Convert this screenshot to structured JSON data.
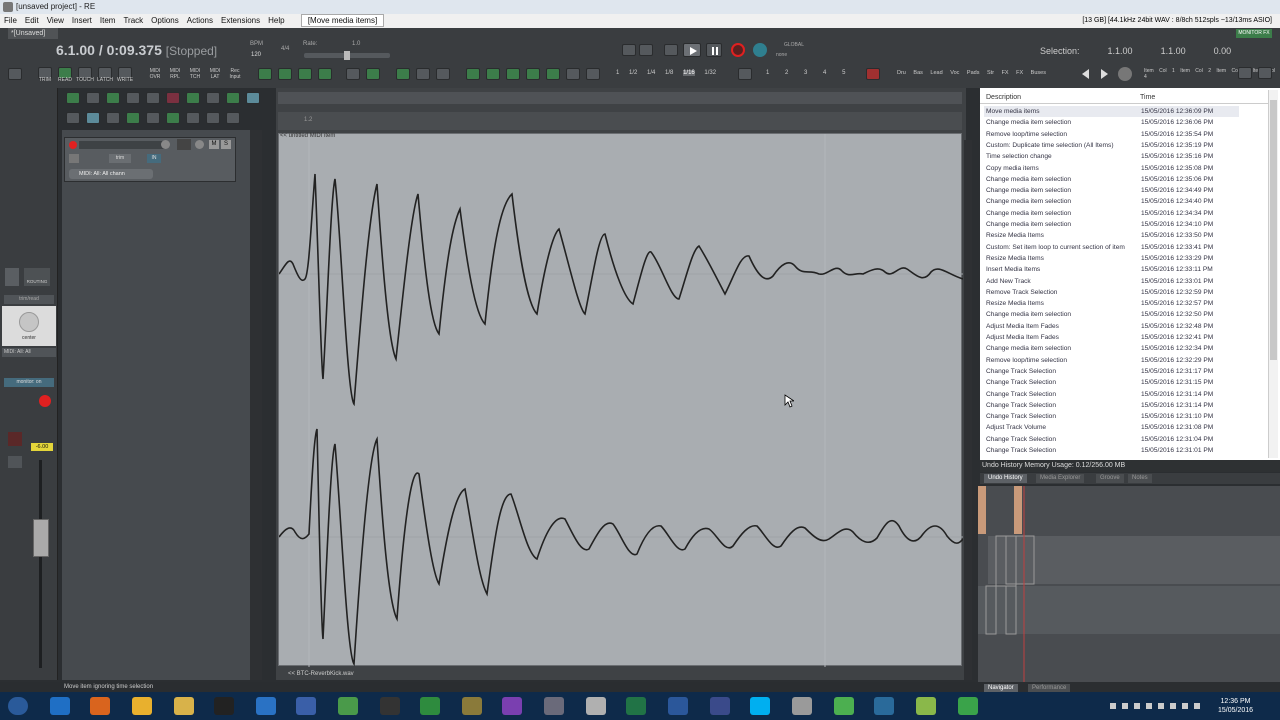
{
  "window": {
    "title": "[unsaved project] - RE",
    "project_tab": "*[Unsaved]"
  },
  "menu": {
    "items": [
      "File",
      "Edit",
      "View",
      "Insert",
      "Item",
      "Track",
      "Options",
      "Actions",
      "Extensions",
      "Help"
    ],
    "last_action": "[Move media items]",
    "audio_status": "[13 GB] [44.1kHz 24bit WAV : 8/8ch 512spls ~13/13ms ASIO]"
  },
  "transport": {
    "position": "6.1.00 / 0:09.375",
    "state": "[Stopped]",
    "bpm_label": "BPM",
    "bpm": "120",
    "timesig": "4/4",
    "rate_label": "Rate:",
    "rate": "1.0",
    "global_label": "GLOBAL",
    "global_sub": "none",
    "monitor_fx": "MONITOR FX"
  },
  "selection": {
    "label": "Selection:",
    "start": "1.1.00",
    "end": "1.1.00",
    "length": "0.00"
  },
  "toolbar_labels": [
    "TRIM",
    "READ",
    "TOUCH",
    "LATCH",
    "WRITE"
  ],
  "midi_labels": [
    "MIDI OVR",
    "MIDI RPL",
    "MIDI TCH",
    "MIDI LAT",
    "Rec Input"
  ],
  "grid_labels": [
    "1",
    "1/2",
    "1/4",
    "1/8",
    "1/16",
    "1/32"
  ],
  "num_labels": [
    "1",
    "2",
    "3",
    "4",
    "5"
  ],
  "cat_labels": [
    "Dru",
    "Bas",
    "Lead",
    "Voc",
    "Pads",
    "Str",
    "FX",
    "FX Buses"
  ],
  "itemcol_labels": [
    "Item Col 1",
    "Item Col 2",
    "Item Col 3",
    "Item Col 4"
  ],
  "track": {
    "midi_channel": "MIDI: All: All chann",
    "trim_label": "trim",
    "in_label": "IN",
    "m": "M",
    "s": "S"
  },
  "mixer": {
    "routing": "ROUTING",
    "trim_read": "trim/read",
    "pan": "center",
    "midi_channel": "MIDI: All: All",
    "monitor": "monitor: on",
    "volume": "-6.00"
  },
  "editor": {
    "ruler_mark": "1.2",
    "item_name": "<< untitled MIDI item",
    "item_name_bottom": "<< BTC-ReverbKick.wav"
  },
  "history": {
    "col_description": "Description",
    "col_time": "Time",
    "rows": [
      {
        "d": "Move media items",
        "t": "15/05/2016 12:36:09 PM"
      },
      {
        "d": "Change media item selection",
        "t": "15/05/2016 12:36:06 PM"
      },
      {
        "d": "Remove loop/time selection",
        "t": "15/05/2016 12:35:54 PM"
      },
      {
        "d": "Custom: Duplicate time selection (All Items)",
        "t": "15/05/2016 12:35:19 PM"
      },
      {
        "d": "Time selection change",
        "t": "15/05/2016 12:35:16 PM"
      },
      {
        "d": "Copy media items",
        "t": "15/05/2016 12:35:08 PM"
      },
      {
        "d": "Change media item selection",
        "t": "15/05/2016 12:35:06 PM"
      },
      {
        "d": "Change media item selection",
        "t": "15/05/2016 12:34:49 PM"
      },
      {
        "d": "Change media item selection",
        "t": "15/05/2016 12:34:40 PM"
      },
      {
        "d": "Change media item selection",
        "t": "15/05/2016 12:34:34 PM"
      },
      {
        "d": "Change media item selection",
        "t": "15/05/2016 12:34:10 PM"
      },
      {
        "d": "Resize Media Items",
        "t": "15/05/2016 12:33:50 PM"
      },
      {
        "d": "Custom: Set item loop to current section of item",
        "t": "15/05/2016 12:33:41 PM"
      },
      {
        "d": "Resize Media Items",
        "t": "15/05/2016 12:33:29 PM"
      },
      {
        "d": "Insert Media Items",
        "t": "15/05/2016 12:33:11 PM"
      },
      {
        "d": "Add New Track",
        "t": "15/05/2016 12:33:01 PM"
      },
      {
        "d": "Remove Track Selection",
        "t": "15/05/2016 12:32:59 PM"
      },
      {
        "d": "Resize Media Items",
        "t": "15/05/2016 12:32:57 PM"
      },
      {
        "d": "Change media item selection",
        "t": "15/05/2016 12:32:50 PM"
      },
      {
        "d": "Adjust Media Item Fades",
        "t": "15/05/2016 12:32:48 PM"
      },
      {
        "d": "Adjust Media Item Fades",
        "t": "15/05/2016 12:32:41 PM"
      },
      {
        "d": "Change media item selection",
        "t": "15/05/2016 12:32:34 PM"
      },
      {
        "d": "Remove loop/time selection",
        "t": "15/05/2016 12:32:29 PM"
      },
      {
        "d": "Change Track Selection",
        "t": "15/05/2016 12:31:17 PM"
      },
      {
        "d": "Change Track Selection",
        "t": "15/05/2016 12:31:15 PM"
      },
      {
        "d": "Change Track Selection",
        "t": "15/05/2016 12:31:14 PM"
      },
      {
        "d": "Change Track Selection",
        "t": "15/05/2016 12:31:14 PM"
      },
      {
        "d": "Change Track Selection",
        "t": "15/05/2016 12:31:10 PM"
      },
      {
        "d": "Adjust Track Volume",
        "t": "15/05/2016 12:31:08 PM"
      },
      {
        "d": "Change Track Selection",
        "t": "15/05/2016 12:31:04 PM"
      },
      {
        "d": "Change Track Selection",
        "t": "15/05/2016 12:31:01 PM"
      }
    ],
    "memory": "Undo History Memory Usage: 0.12/256.00 MB",
    "tabs": [
      "Undo History",
      "Media Explorer",
      "Groove",
      "Notes"
    ],
    "nav_tabs": [
      "Navigator",
      "Performance"
    ]
  },
  "status": {
    "text": "Move item ignoring time selection"
  },
  "clock": {
    "time": "12:36 PM",
    "date": "15/05/2016"
  },
  "colors": {
    "accent_green": "#3c7d4a",
    "record_red": "#e02020",
    "taskbar": "#0e2a4a"
  }
}
